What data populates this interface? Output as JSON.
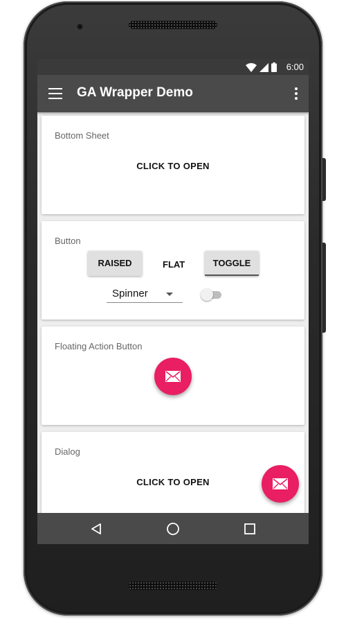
{
  "status_bar": {
    "time": "6:00",
    "icons": [
      "wifi-icon",
      "signal-icon",
      "battery-icon"
    ]
  },
  "toolbar": {
    "title": "GA Wrapper Demo",
    "nav_icon": "menu-icon",
    "overflow_icon": "more-vert-icon"
  },
  "cards": {
    "bottom_sheet": {
      "title": "Bottom Sheet",
      "action": "CLICK TO OPEN"
    },
    "button": {
      "title": "Button",
      "raised_label": "RAISED",
      "flat_label": "FLAT",
      "toggle_label": "TOGGLE",
      "spinner_value": "Spinner",
      "switch_on": false
    },
    "fab": {
      "title": "Floating Action Button",
      "icon": "email-icon"
    },
    "dialog": {
      "title": "Dialog",
      "action": "CLICK TO OPEN"
    }
  },
  "floating_fab": {
    "icon": "email-icon"
  },
  "nav_bar": {
    "icons": [
      "back-icon",
      "home-icon",
      "recents-icon"
    ]
  },
  "colors": {
    "accent": "#e91e63",
    "toolbar": "#4a4a4a",
    "status_bar": "#3a3a3a",
    "background": "#eeeeee"
  }
}
